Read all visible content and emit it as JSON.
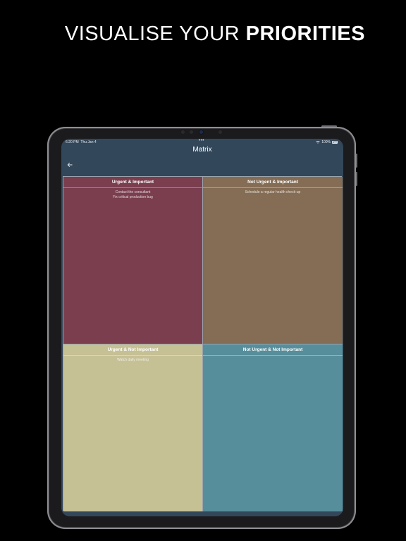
{
  "promo": {
    "headline_light": "VISUALISE YOUR ",
    "headline_bold": "PRIORITIES"
  },
  "status_bar": {
    "time": "6:20 PM",
    "date": "Thu Jan 4",
    "multitask_dots": "•••",
    "battery": "100%"
  },
  "nav": {
    "title": "Matrix",
    "back_icon": "back-arrow-icon"
  },
  "matrix": {
    "quadrants": [
      {
        "title": "Urgent & Important",
        "color": "#7a3e4f",
        "tasks": [
          "Contact the consultant",
          "Fix critical production bug"
        ]
      },
      {
        "title": "Not Urgent & Important",
        "color": "#856d55",
        "tasks": [
          "Schedule a regular health check-up"
        ]
      },
      {
        "title": "Urgent & Not Important",
        "color": "#c6c095",
        "tasks": [
          "Watch daily meeting"
        ]
      },
      {
        "title": "Not Urgent & Not Important",
        "color": "#578e9b",
        "tasks": []
      }
    ]
  },
  "colors": {
    "background": "#000000",
    "screen_bg": "#33475a"
  }
}
